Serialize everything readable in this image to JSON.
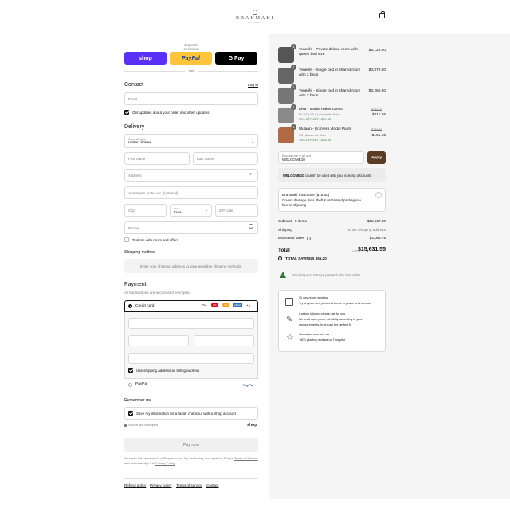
{
  "header": {
    "brand": "BRAHMAKI",
    "brand_sub": "LUXURY",
    "cart_icon": "shopping-bag-icon"
  },
  "express": {
    "title": "Express checkout",
    "shop_label": "shop",
    "paypal_label": "PayPal",
    "gpay_label": "G Pay",
    "or_label": "OR"
  },
  "contact": {
    "title": "Contact",
    "login": "Log in",
    "email_placeholder": "Email",
    "updates_label": "Get updates about your order and other updates"
  },
  "delivery": {
    "title": "Delivery",
    "country_label": "Country/Region",
    "country_value": "United States",
    "first_name": "First name",
    "last_name": "Last name",
    "address": "Address",
    "apartment": "Apartment, suite, etc. (optional)",
    "city": "City",
    "state_label": "State",
    "state_value": "Iowa",
    "zip": "ZIP code",
    "phone": "Phone",
    "text_offers": "Text me with news and offers"
  },
  "shipping": {
    "title": "Shipping method",
    "message": "Enter your shipping address to view available shipping methods."
  },
  "payment": {
    "title": "Payment",
    "subtitle": "All transactions are secure and encrypted.",
    "credit_card": "Credit card",
    "cards": [
      "VISA",
      "MC",
      "MC",
      "AMEX"
    ],
    "more_cards": "+1",
    "billing_same": "Use shipping address as billing address",
    "paypal": "PayPal",
    "paypal_logo": "PayPal"
  },
  "remember": {
    "title": "Remember me",
    "save_info": "Save my information for a faster checkout with a Shop account",
    "secure": "Secure and encrypted",
    "shop_logo": "shop"
  },
  "pay_now": "Pay now",
  "legal": {
    "line1": "Your info will be saved to a Shop account. By continuing, you agree to Shop's",
    "tos": "Terms of Service",
    "and_ack": "and acknowledge the",
    "privacy": "Privacy Policy"
  },
  "footer_links": [
    "Refund policy",
    "Privacy policy",
    "Terms of service",
    "Contact"
  ],
  "items": [
    {
      "qty": "1",
      "title": "Tenerife - Private deluxe room with queen bed size",
      "price": "$5,125.00",
      "old_price": "",
      "sub": "",
      "discount": ""
    },
    {
      "qty": "1",
      "title": "Tenerife - Single bed in shared room with 2 beds",
      "price": "$3,870.00",
      "old_price": "",
      "sub": "",
      "discount": ""
    },
    {
      "qty": "1",
      "title": "Tenerife - Single bed in shared room with 3 beds",
      "price": "$3,260.00",
      "old_price": "",
      "sub": "",
      "discount": ""
    },
    {
      "qty": "1",
      "title": "Elsa - Modal Halter Dress",
      "price": "$211.65",
      "old_price": "$249.00",
      "sub": "EU 52 | US 9 | Above the Bum",
      "discount": "15% OFF SET (-$37.35)"
    },
    {
      "qty": "1",
      "title": "Mulaan - EcoVero Modal Pants",
      "price": "$161.15",
      "old_price": "$189.59",
      "sub": "XS | Above the Bum",
      "discount": "15% OFF SET (-$18.44)"
    }
  ],
  "discount": {
    "label": "Discount code or gift card",
    "value": "WELCOME10",
    "apply": "Apply",
    "error_code": "WELCOME10",
    "error_text": "couldn't be used with your existing discounts."
  },
  "insurance": {
    "title": "Brahmaki Insurance ($16.00)",
    "desc": "Covers damage, loss, theft & unclaimed packages + free re-shipping"
  },
  "summary": {
    "subtotal_label": "Subtotal · 5 items",
    "subtotal_value": "$12,567.80",
    "shipping_label": "Shipping",
    "shipping_value": "Enter shipping address",
    "taxes_label": "Estimated taxes",
    "taxes_value": "$3,063.75",
    "total_label": "Total",
    "currency": "USD",
    "total_value": "$15,631.55",
    "savings_label": "TOTAL SAVINGS",
    "savings_value": "$55.20"
  },
  "impact": "Your impact: 5 trees planted with this order",
  "benefits": [
    {
      "icon": "calendar-icon",
      "title": "30 day return window",
      "text": "Try on your new pieces at home in peace and comfort"
    },
    {
      "icon": "needle-icon",
      "title": "Custom tailored pieces just for you",
      "text": "We craft each piece mindfully according to your measurements, to ensure the perfect fit"
    },
    {
      "icon": "star-icon",
      "title": "Our customers love us",
      "text": "+800 glowing reviews on Trustpilot"
    }
  ]
}
